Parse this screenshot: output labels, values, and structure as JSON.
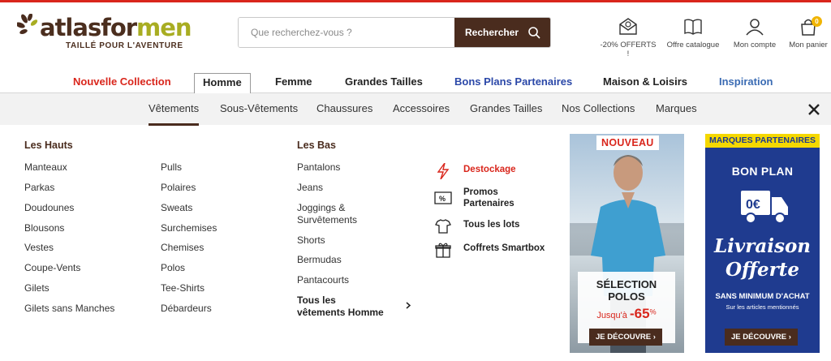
{
  "brand": {
    "name_part1": "atlasfor",
    "name_part2": "men",
    "tagline": "TAILLÉ POUR L'AVENTURE"
  },
  "search": {
    "placeholder": "Que recherchez-vous ?",
    "button": "Rechercher"
  },
  "tools": {
    "offers": "-20% OFFERTS !",
    "catalog": "Offre catalogue",
    "account": "Mon compte",
    "cart": "Mon panier",
    "cart_count": "0"
  },
  "main_nav": [
    "Nouvelle Collection",
    "Homme",
    "Femme",
    "Grandes Tailles",
    "Bons Plans Partenaires",
    "Maison & Loisirs",
    "Inspiration"
  ],
  "sub_nav": [
    "Vêtements",
    "Sous-Vêtements",
    "Chaussures",
    "Accessoires",
    "Grandes Tailles",
    "Nos Collections",
    "Marques"
  ],
  "hauts": {
    "title": "Les Hauts",
    "col1": [
      "Manteaux",
      "Parkas",
      "Doudounes",
      "Blousons",
      "Vestes",
      "Coupe-Vents",
      "Gilets",
      "Gilets sans Manches"
    ],
    "col2": [
      "Pulls",
      "Polaires",
      "Sweats",
      "Surchemises",
      "Chemises",
      "Polos",
      "Tee-Shirts",
      "Débardeurs"
    ]
  },
  "bas": {
    "title": "Les Bas",
    "items": [
      "Pantalons",
      "Jeans",
      "Joggings & Survêtements",
      "Shorts",
      "Bermudas",
      "Pantacourts"
    ],
    "all": "Tous les vêtements Homme"
  },
  "promos": {
    "destockage": "Destockage",
    "partenaires": "Promos Partenaires",
    "lots": "Tous les lots",
    "smartbox": "Coffrets Smartbox"
  },
  "banner_polos": {
    "badge": "NOUVEAU",
    "title": "SÉLECTION POLOS",
    "until": "Jusqu'à",
    "discount": "-65",
    "pct": "%",
    "cta": "JE DÉCOUVRE ›"
  },
  "banner_livraison": {
    "header": "MARQUES PARTENAIRES",
    "bon_plan": "BON PLAN",
    "truck_price": "0€",
    "title_line1": "Livraison",
    "title_line2": "Offerte",
    "sub": "SANS MINIMUM D'ACHAT",
    "sub2": "Sur les articles mentionnés",
    "cta": "JE DÉCOUVRE ›"
  },
  "colors": {
    "brand_brown": "#4a2c1e",
    "brand_olive": "#a8ad22",
    "accent_red": "#d9261c",
    "partner_blue": "#1f3b8f",
    "partner_yellow": "#f5d800"
  }
}
